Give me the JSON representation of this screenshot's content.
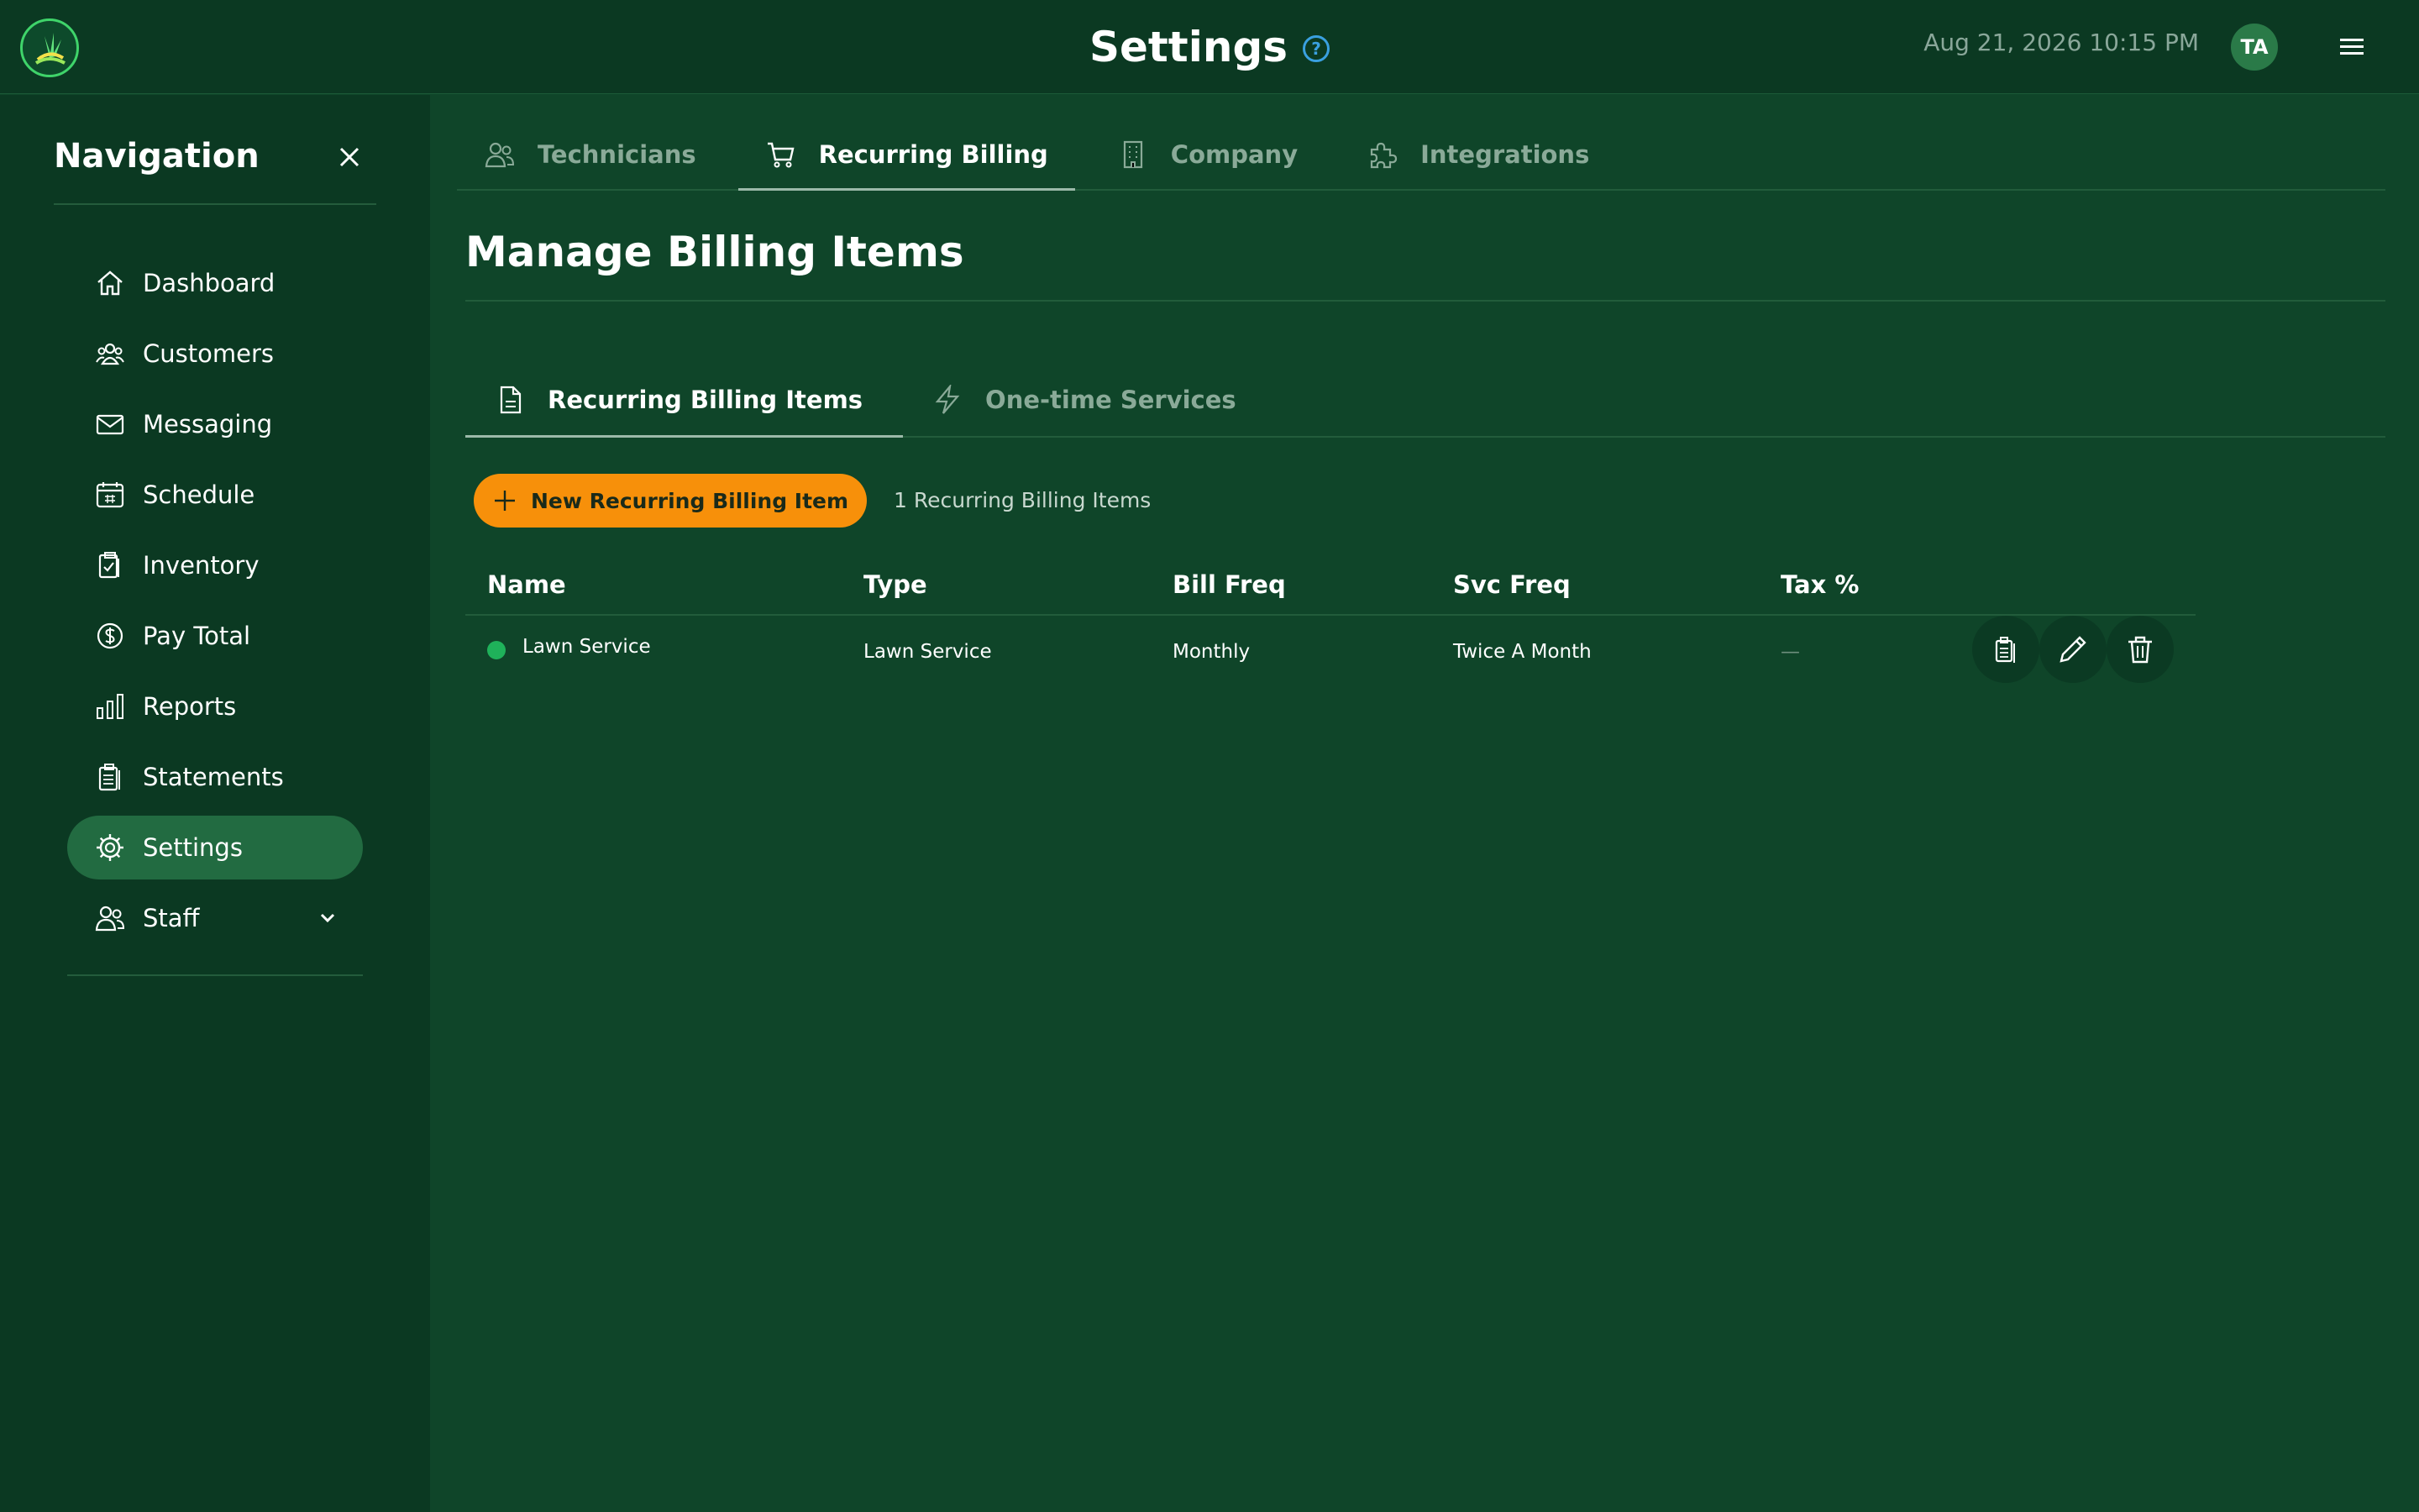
{
  "header": {
    "title": "Settings",
    "help_glyph": "?",
    "datetime": "Aug 21, 2026 10:15 PM",
    "avatar_initials": "TA"
  },
  "navigation": {
    "title": "Navigation",
    "items": [
      {
        "label": "Dashboard",
        "icon": "home-icon",
        "active": false
      },
      {
        "label": "Customers",
        "icon": "users-icon",
        "active": false
      },
      {
        "label": "Messaging",
        "icon": "mail-icon",
        "active": false
      },
      {
        "label": "Schedule",
        "icon": "calendar-icon",
        "active": false
      },
      {
        "label": "Inventory",
        "icon": "clipboard-check-icon",
        "active": false
      },
      {
        "label": "Pay Total",
        "icon": "dollar-icon",
        "active": false
      },
      {
        "label": "Reports",
        "icon": "bar-chart-icon",
        "active": false
      },
      {
        "label": "Statements",
        "icon": "statements-icon",
        "active": false
      },
      {
        "label": "Settings",
        "icon": "gear-icon",
        "active": true
      },
      {
        "label": "Staff",
        "icon": "staff-icon",
        "active": false
      }
    ]
  },
  "tabs": [
    {
      "label": "Technicians",
      "icon": "people-icon",
      "active": false
    },
    {
      "label": "Recurring Billing",
      "icon": "cart-icon",
      "active": true
    },
    {
      "label": "Company",
      "icon": "building-icon",
      "active": false
    },
    {
      "label": "Integrations",
      "icon": "puzzle-icon",
      "active": false
    }
  ],
  "section": {
    "title": "Manage Billing Items",
    "subtabs": [
      {
        "label": "Recurring Billing Items",
        "icon": "document-icon",
        "active": true
      },
      {
        "label": "One-time Services",
        "icon": "lightning-icon",
        "active": false
      }
    ],
    "new_button": "New Recurring Billing Item",
    "count_text": "1 Recurring Billing Items"
  },
  "table": {
    "columns": [
      "Name",
      "Type",
      "Bill Freq",
      "Svc Freq",
      "Tax %"
    ],
    "rows": [
      {
        "name": "Lawn Service",
        "type": "Lawn Service",
        "bill_freq": "Monthly",
        "svc_freq": "Twice A Month",
        "tax": "—"
      }
    ]
  },
  "colors": {
    "background": "#0f4529",
    "sidebar": "#0b3922",
    "accent_orange": "#f7900a",
    "active_nav": "#226b41",
    "status_active": "#1fb25a"
  }
}
